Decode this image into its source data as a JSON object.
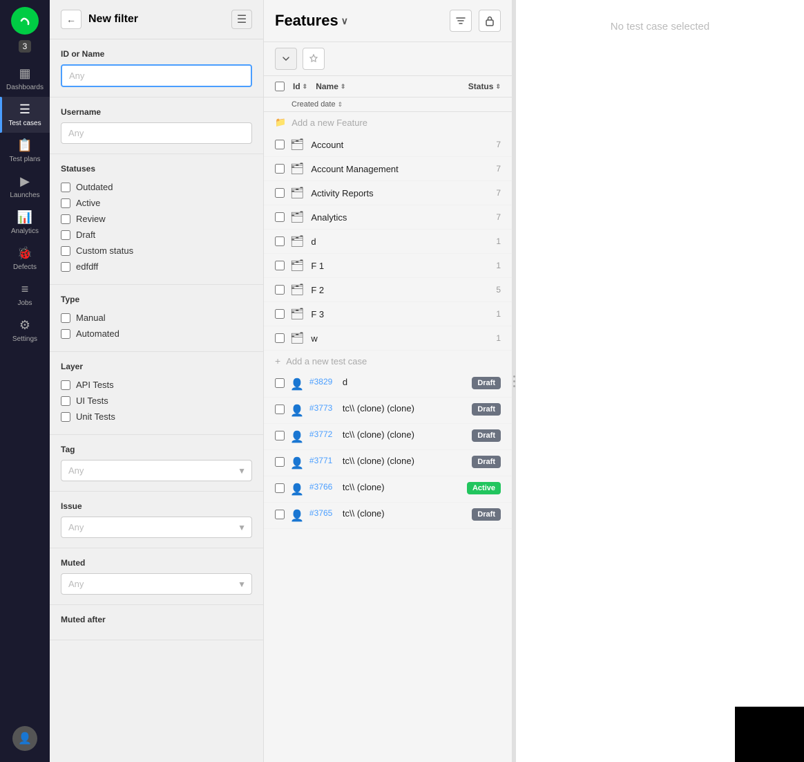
{
  "sidebar": {
    "badge": "3",
    "items": [
      {
        "id": "dashboards",
        "label": "Dashboards",
        "icon": "▦",
        "active": false
      },
      {
        "id": "test-cases",
        "label": "Test cases",
        "icon": "☰",
        "active": true
      },
      {
        "id": "test-plans",
        "label": "Test plans",
        "icon": "📋",
        "active": false
      },
      {
        "id": "launches",
        "label": "Launches",
        "icon": "▶",
        "active": false
      },
      {
        "id": "analytics",
        "label": "Analytics",
        "icon": "📊",
        "active": false
      },
      {
        "id": "defects",
        "label": "Defects",
        "icon": "🐞",
        "active": false
      },
      {
        "id": "jobs",
        "label": "Jobs",
        "icon": "≡",
        "active": false
      },
      {
        "id": "settings",
        "label": "Settings",
        "icon": "⚙",
        "active": false
      }
    ]
  },
  "filter": {
    "title": "New filter",
    "id_or_name_label": "ID or Name",
    "id_or_name_placeholder": "Any",
    "username_label": "Username",
    "username_placeholder": "Any",
    "statuses_label": "Statuses",
    "statuses": [
      {
        "id": "outdated",
        "label": "Outdated",
        "checked": false
      },
      {
        "id": "active",
        "label": "Active",
        "checked": false
      },
      {
        "id": "review",
        "label": "Review",
        "checked": false
      },
      {
        "id": "draft",
        "label": "Draft",
        "checked": false
      },
      {
        "id": "custom-status",
        "label": "Custom status",
        "checked": false
      },
      {
        "id": "edfdff",
        "label": "edfdff",
        "checked": false
      }
    ],
    "type_label": "Type",
    "types": [
      {
        "id": "manual",
        "label": "Manual",
        "checked": false
      },
      {
        "id": "automated",
        "label": "Automated",
        "checked": false
      }
    ],
    "layer_label": "Layer",
    "layers": [
      {
        "id": "api-tests",
        "label": "API Tests",
        "checked": false
      },
      {
        "id": "ui-tests",
        "label": "UI Tests",
        "checked": false
      },
      {
        "id": "unit-tests",
        "label": "Unit Tests",
        "checked": false
      }
    ],
    "tag_label": "Tag",
    "tag_placeholder": "Any",
    "issue_label": "Issue",
    "issue_placeholder": "Any",
    "muted_label": "Muted",
    "muted_placeholder": "Any",
    "muted_after_label": "Muted after"
  },
  "features": {
    "title": "Features",
    "table_headers": {
      "id": "Id",
      "name": "Name",
      "status": "Status",
      "created_date": "Created date"
    },
    "add_feature_label": "Add a new Feature",
    "add_test_case_label": "Add a new test case",
    "folders": [
      {
        "name": "Account",
        "count": 7
      },
      {
        "name": "Account Management",
        "count": 7
      },
      {
        "name": "Activity Reports",
        "count": 7
      },
      {
        "name": "Analytics",
        "count": 7
      },
      {
        "name": "d",
        "count": 1
      },
      {
        "name": "F 1",
        "count": 1
      },
      {
        "name": "F 2",
        "count": 5
      },
      {
        "name": "F 3",
        "count": 1
      },
      {
        "name": "w",
        "count": 1
      }
    ],
    "test_cases": [
      {
        "id": "#3829",
        "name": "d",
        "status": "Draft",
        "status_type": "draft"
      },
      {
        "id": "#3773",
        "name": "tc\\\\ (clone) (clone)",
        "status": "Draft",
        "status_type": "draft"
      },
      {
        "id": "#3772",
        "name": "tc\\\\ (clone) (clone)",
        "status": "Draft",
        "status_type": "draft"
      },
      {
        "id": "#3771",
        "name": "tc\\\\ (clone) (clone)",
        "status": "Draft",
        "status_type": "draft"
      },
      {
        "id": "#3766",
        "name": "tc\\\\ (clone)",
        "status": "Active",
        "status_type": "active"
      },
      {
        "id": "#3765",
        "name": "tc\\\\ (clone)",
        "status": "Draft",
        "status_type": "draft"
      }
    ]
  },
  "right_panel": {
    "no_selection": "No test case selected"
  }
}
